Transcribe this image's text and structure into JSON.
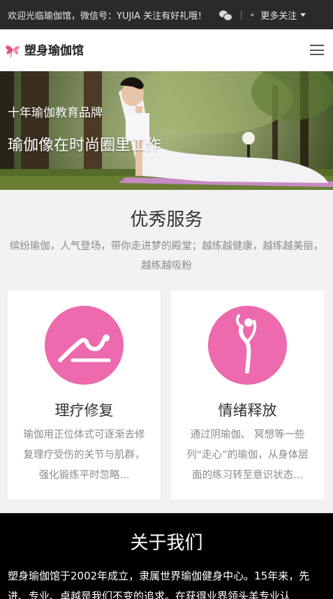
{
  "topbar": {
    "welcome": "欢迎光临瑜伽馆，微信号：YUJIA 关注有好礼哦！",
    "more_label": "更多关注"
  },
  "header": {
    "logo_text": "塑身瑜伽馆"
  },
  "hero": {
    "subtitle": "十年瑜伽教育品牌",
    "title": "瑜伽像在时尚圈里工作"
  },
  "services": {
    "title": "优秀服务",
    "description": "缤纷瑜伽，人气登场，带你走进梦的殿堂；越练越健康，越练越美丽，越练越吸粉",
    "cards": [
      {
        "icon": "yoga-stretch-icon",
        "title": "理疗修复",
        "text": "瑜伽用正位体式可逐渐去修复理疗受伤的关节与肌群，强化锻炼平时忽略..."
      },
      {
        "icon": "yoga-pose-icon",
        "title": "情绪释放",
        "text": "通过阴瑜伽、 冥想等一些列“走心”的瑜伽，从身体层面的练习转至意识状态..."
      }
    ]
  },
  "about": {
    "title": "关于我们",
    "text": "塑身瑜伽馆于2002年成立，隶属世界瑜伽健身中心。15年来，先进、专业、卓越是我们不变的追求。在获得业界领头羊专业认"
  },
  "colors": {
    "accent_pink": "#ec6aad",
    "topbar_bg": "#2a2a2a",
    "about_bg": "#000000"
  }
}
